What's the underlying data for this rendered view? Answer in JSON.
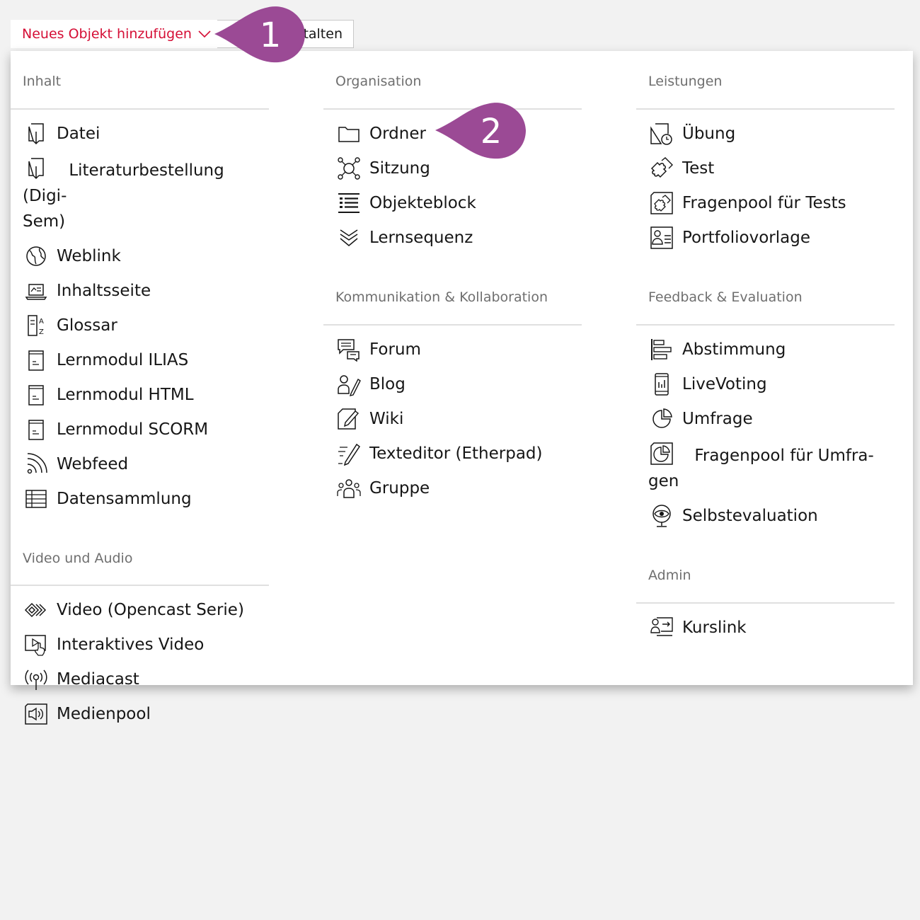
{
  "toolbar": {
    "add_object_label": "Neues Objekt hinzufügen",
    "edit_label_visible": "talten"
  },
  "callouts": {
    "one": "1",
    "two": "2"
  },
  "colors": {
    "accent": "#d50f36",
    "callout": "#9b4a95"
  },
  "menu": {
    "inhalt": {
      "title": "Inhalt",
      "items": [
        {
          "label": "Datei",
          "icon": "file-download-icon"
        },
        {
          "label": "Literaturbestellung (Digi-Sem)",
          "icon": "file-download-icon"
        },
        {
          "label": "Weblink",
          "icon": "globe-link-icon"
        },
        {
          "label": "Inhaltsseite",
          "icon": "laptop-page-icon"
        },
        {
          "label": "Glossar",
          "icon": "glossary-az-icon"
        },
        {
          "label": "Lernmodul ILIAS",
          "icon": "module-document-icon"
        },
        {
          "label": "Lernmodul HTML",
          "icon": "module-document-icon"
        },
        {
          "label": "Lernmodul SCORM",
          "icon": "module-document-icon"
        },
        {
          "label": "Webfeed",
          "icon": "rss-feed-icon"
        },
        {
          "label": "Datensammlung",
          "icon": "table-grid-icon"
        }
      ]
    },
    "video": {
      "title": "Video und Audio",
      "items": [
        {
          "label": "Video (Opencast Serie)",
          "icon": "opencast-icon"
        },
        {
          "label": "Interaktives Video",
          "icon": "interactive-video-icon"
        },
        {
          "label": "Mediacast",
          "icon": "broadcast-icon"
        },
        {
          "label": "Medienpool",
          "icon": "media-speaker-icon"
        }
      ]
    },
    "organisation": {
      "title": "Organisation",
      "items": [
        {
          "label": "Ordner",
          "icon": "folder-icon"
        },
        {
          "label": "Sitzung",
          "icon": "session-network-icon"
        },
        {
          "label": "Objekteblock",
          "icon": "list-block-icon"
        },
        {
          "label": "Lernsequenz",
          "icon": "chevron-stack-icon"
        }
      ]
    },
    "kommunikation": {
      "title": "Kommunikation & Kollaboration",
      "items": [
        {
          "label": "Forum",
          "icon": "chat-bubbles-icon"
        },
        {
          "label": "Blog",
          "icon": "person-pen-icon"
        },
        {
          "label": "Wiki",
          "icon": "edit-page-icon"
        },
        {
          "label": "Texteditor (Etherpad)",
          "icon": "pencil-lines-icon"
        },
        {
          "label": "Gruppe",
          "icon": "group-people-icon"
        }
      ]
    },
    "leistungen": {
      "title": "Leistungen",
      "items": [
        {
          "label": "Übung",
          "icon": "exercise-clock-icon"
        },
        {
          "label": "Test",
          "icon": "puzzle-icon"
        },
        {
          "label": "Fragenpool für Tests",
          "icon": "puzzle-pool-icon"
        },
        {
          "label": "Portfoliovorlage",
          "icon": "portfolio-card-icon"
        }
      ]
    },
    "feedback": {
      "title": "Feedback & Evaluation",
      "items": [
        {
          "label": "Abstimmung",
          "icon": "bar-poll-icon"
        },
        {
          "label": "LiveVoting",
          "icon": "phone-chart-icon"
        },
        {
          "label": "Umfrage",
          "icon": "pie-survey-icon"
        },
        {
          "label": "Fragenpool für Umfra-gen",
          "icon": "pie-pool-icon"
        },
        {
          "label": "Selbstevaluation",
          "icon": "eye-stand-icon"
        }
      ]
    },
    "admin": {
      "title": "Admin",
      "items": [
        {
          "label": "Kurslink",
          "icon": "course-link-icon"
        }
      ]
    }
  }
}
